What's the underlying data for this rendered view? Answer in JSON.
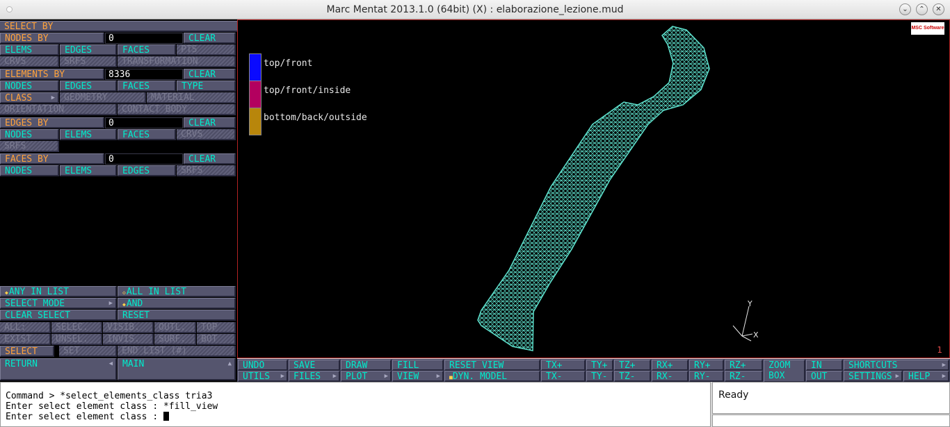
{
  "window": {
    "title": "Marc Mentat 2013.1.0 (64bit) (X) : elaborazione_lezione.mud",
    "minimize_glyph": "⌄",
    "maximize_glyph": "⌃",
    "close_glyph": "✕"
  },
  "select_panel": {
    "title": "SELECT BY",
    "nodes_by": {
      "label": "NODES BY",
      "value": "0",
      "clear": "CLEAR"
    },
    "nodes_row1": [
      "ELEMS",
      "EDGES",
      "FACES",
      "PTS"
    ],
    "nodes_row2": [
      "CRVS",
      "SRFS",
      "TRANSFORMATION"
    ],
    "elements_by": {
      "label": "ELEMENTS BY",
      "value": "8336",
      "clear": "CLEAR"
    },
    "elements_row1": [
      "NODES",
      "EDGES",
      "FACES",
      "TYPE"
    ],
    "elements_row2": [
      "CLASS",
      "GEOMETRY",
      "MATERIAL"
    ],
    "elements_row3": [
      "ORIENTATION",
      "CONTACT BODY"
    ],
    "edges_by": {
      "label": "EDGES BY",
      "value": "0",
      "clear": "CLEAR"
    },
    "edges_row1": [
      "NODES",
      "ELEMS",
      "FACES",
      "CRVS"
    ],
    "edges_row2": [
      "SRFS"
    ],
    "faces_by": {
      "label": "FACES BY",
      "value": "0",
      "clear": "CLEAR"
    },
    "faces_row1": [
      "NODES",
      "ELEMS",
      "EDGES",
      "SRFS"
    ],
    "any_in_list": "ANY IN LIST",
    "all_in_list": "ALL IN LIST",
    "select_mode": "SELECT MODE",
    "mode_value": "AND",
    "clear_select": "CLEAR SELECT",
    "reset": "RESET",
    "grid_row1": [
      "ALL:",
      "SELEC.",
      "VISIB.",
      "OUTL.",
      "TOP"
    ],
    "grid_row2": [
      "EXIST.",
      "UNSEL.",
      "INVIS.",
      "SURF.",
      "BOT"
    ],
    "select": "SELECT",
    "set": "SET",
    "end_list": "END LIST (#)",
    "return": "RETURN",
    "main": "MAIN"
  },
  "viewport": {
    "legend": [
      {
        "label": "top/front",
        "color": "#0a0aff"
      },
      {
        "label": "top/front/inside",
        "color": "#b3005f"
      },
      {
        "label": "bottom/back/outside",
        "color": "#b8860b"
      }
    ],
    "mesh_color": "#5ee0cc",
    "logo_text": "MSC Software",
    "axis_y": "Y",
    "axis_x": "X",
    "view_number": "1"
  },
  "toolbar": {
    "undo": "UNDO",
    "save": "SAVE",
    "draw": "DRAW",
    "fill": "FILL",
    "reset_view": "RESET VIEW",
    "utils": "UTILS",
    "files": "FILES",
    "plot": "PLOT",
    "view": "VIEW",
    "dyn_model": "DYN. MODEL",
    "tx_plus": "TX+",
    "ty_plus": "TY+",
    "tz_plus": "TZ+",
    "rx_plus": "RX+",
    "ry_plus": "RY+",
    "rz_plus": "RZ+",
    "tx_minus": "TX-",
    "ty_minus": "TY-",
    "tz_minus": "TZ-",
    "rx_minus": "RX-",
    "ry_minus": "RY-",
    "rz_minus": "RZ-",
    "zoom": "ZOOM",
    "box": "BOX",
    "in": "IN",
    "out": "OUT",
    "shortcuts": "SHORTCUTS",
    "settings": "SETTINGS",
    "help": "HELP"
  },
  "command": {
    "line1": "Command > *select_elements_class tria3",
    "line2": "Enter select element class : *fill_view",
    "line3": "Enter select element class : "
  },
  "status": {
    "text": "Ready"
  }
}
